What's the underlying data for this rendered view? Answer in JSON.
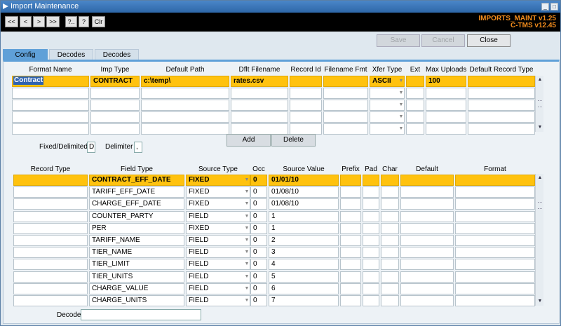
{
  "window": {
    "title": "Import Maintenance",
    "minimize_label": "_",
    "restore_label": "□"
  },
  "toolbar": {
    "buttons": [
      "<<",
      "<",
      ">",
      ">>",
      "?..",
      "?",
      "Clr"
    ],
    "version_line1": "IMPORTS_MAINT v1.25",
    "version_line2": "C-TMS v12.45"
  },
  "actions": {
    "save": "Save",
    "cancel": "Cancel",
    "close": "Close"
  },
  "tabs": [
    "Config",
    "Decodes",
    "Decodes Audit"
  ],
  "format_table": {
    "headers": [
      "Format Name",
      "Imp Type",
      "Default Path",
      "Dflt Filename",
      "Record Id",
      "Filename Fmt",
      "Xfer Type",
      "Ext",
      "Max Uploads",
      "Default Record Type"
    ],
    "rows": [
      [
        "Contract",
        "CONTRACT",
        "c:\\temp\\",
        "rates.csv",
        "",
        "",
        "ASCII",
        "",
        "100",
        ""
      ],
      [
        "",
        "",
        "",
        "",
        "",
        "",
        "",
        "",
        "",
        ""
      ],
      [
        "",
        "",
        "",
        "",
        "",
        "",
        "",
        "",
        "",
        ""
      ],
      [
        "",
        "",
        "",
        "",
        "",
        "",
        "",
        "",
        "",
        ""
      ],
      [
        "",
        "",
        "",
        "",
        "",
        "",
        "",
        "",
        "",
        ""
      ]
    ]
  },
  "fixed_delimited": {
    "label": "Fixed/Delimited",
    "value": "D"
  },
  "delimiter": {
    "label": "Delimiter",
    "value": ","
  },
  "buttons": {
    "add": "Add",
    "delete": "Delete"
  },
  "field_table": {
    "headers": [
      "Record Type",
      "Field Type",
      "Source Type",
      "Occ",
      "Source Value",
      "Prefix",
      "Pad",
      "Char",
      "Default",
      "Format"
    ],
    "rows": [
      [
        "",
        "CONTRACT_EFF_DATE",
        "FIXED",
        "0",
        "01/01/10"
      ],
      [
        "",
        "TARIFF_EFF_DATE",
        "FIXED",
        "0",
        "01/08/10"
      ],
      [
        "",
        "CHARGE_EFF_DATE",
        "FIXED",
        "0",
        "01/08/10"
      ],
      [
        "",
        "COUNTER_PARTY",
        "FIELD",
        "0",
        "1"
      ],
      [
        "",
        "PER",
        "FIXED",
        "0",
        "1"
      ],
      [
        "",
        "TARIFF_NAME",
        "FIELD",
        "0",
        "2"
      ],
      [
        "",
        "TIER_NAME",
        "FIELD",
        "0",
        "3"
      ],
      [
        "",
        "TIER_LIMIT",
        "FIELD",
        "0",
        "4"
      ],
      [
        "",
        "TIER_UNITS",
        "FIELD",
        "0",
        "5"
      ],
      [
        "",
        "CHARGE_VALUE",
        "FIELD",
        "0",
        "6"
      ],
      [
        "",
        "CHARGE_UNITS",
        "FIELD",
        "0",
        "7"
      ]
    ]
  },
  "decode": {
    "label": "Decode",
    "value": ""
  },
  "colors": {
    "selected_row": "#ffc20e",
    "toolbar_bg": "#000000",
    "version_text": "#f28c1c",
    "tab_active": "#5fa0d8"
  }
}
